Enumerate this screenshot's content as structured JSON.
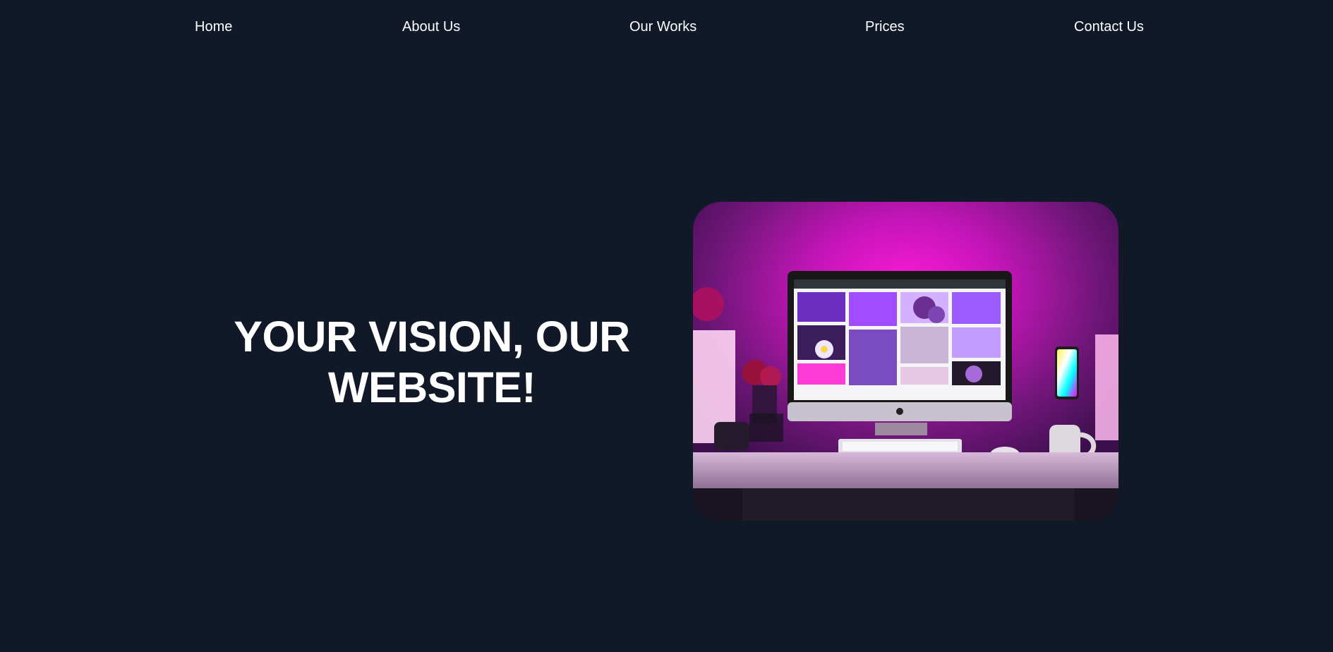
{
  "nav": {
    "items": [
      {
        "label": "Home"
      },
      {
        "label": "About Us"
      },
      {
        "label": "Our Works"
      },
      {
        "label": "Prices"
      },
      {
        "label": "Contact Us"
      }
    ]
  },
  "hero": {
    "title_line1": "YOUR VISION, OUR",
    "title_line2": "WEBSITE!",
    "image_subject": "pink-lit-desktop-computer-setup"
  },
  "colors": {
    "background": "#111827",
    "text": "#ffffff",
    "accent_glow": "#ff00c8",
    "accent_purple": "#7a1f9a"
  }
}
